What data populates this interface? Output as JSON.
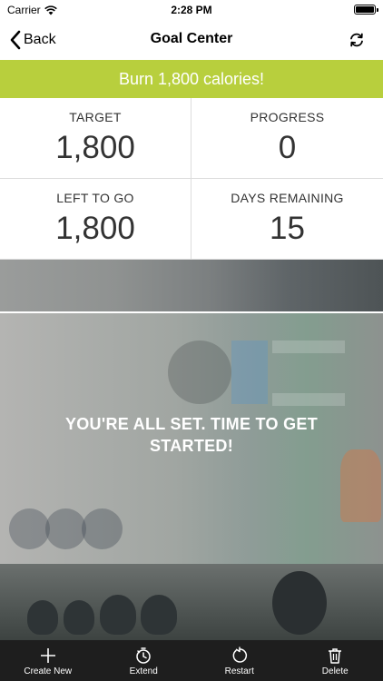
{
  "status_bar": {
    "carrier": "Carrier",
    "time": "2:28 PM"
  },
  "nav": {
    "back_label": "Back",
    "title": "Goal Center",
    "refresh_icon": "refresh-icon"
  },
  "banner": {
    "text": "Burn 1,800 calories!",
    "color": "#b8cf3d"
  },
  "stats": {
    "target": {
      "label": "TARGET",
      "value": "1,800"
    },
    "progress": {
      "label": "PROGRESS",
      "value": "0"
    },
    "left_to_go": {
      "label": "LEFT TO GO",
      "value": "1,800"
    },
    "days_remaining": {
      "label": "DAYS REMAINING",
      "value": "15"
    }
  },
  "message": "YOU'RE ALL SET. TIME TO GET STARTED!",
  "tab_bar": {
    "items": [
      {
        "label": "Create New",
        "icon": "plus-icon"
      },
      {
        "label": "Extend",
        "icon": "stopwatch-icon"
      },
      {
        "label": "Restart",
        "icon": "restart-icon"
      },
      {
        "label": "Delete",
        "icon": "trash-icon"
      }
    ]
  }
}
